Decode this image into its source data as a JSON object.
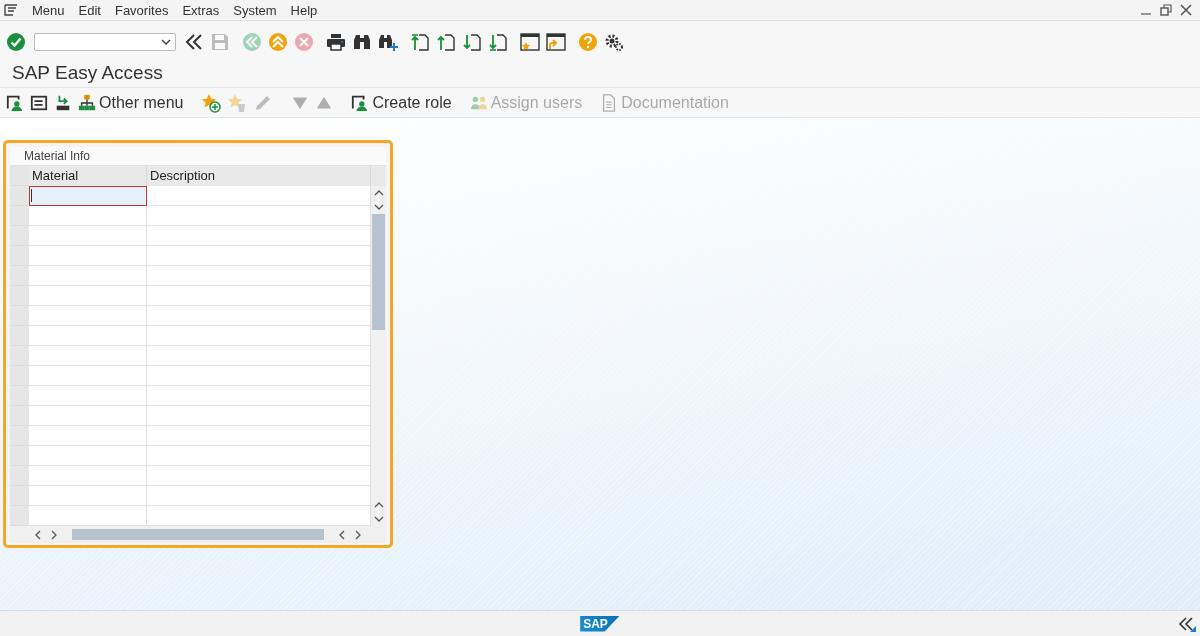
{
  "menu_bar": {
    "items": [
      "Menu",
      "Edit",
      "Favorites",
      "Extras",
      "System",
      "Help"
    ]
  },
  "toolbar": {
    "buttons": [
      {
        "kind": "enter",
        "disabled": false
      },
      {
        "kind": "command-field",
        "disabled": false
      },
      {
        "kind": "collapse",
        "disabled": false
      },
      {
        "kind": "save",
        "disabled": true
      },
      {
        "kind": "back",
        "disabled": true
      },
      {
        "kind": "exit",
        "disabled": false
      },
      {
        "kind": "cancel",
        "disabled": true
      },
      {
        "kind": "print",
        "disabled": false
      },
      {
        "kind": "find",
        "disabled": false
      },
      {
        "kind": "find-next",
        "disabled": false
      },
      {
        "kind": "first-page",
        "disabled": false
      },
      {
        "kind": "prev-page",
        "disabled": false
      },
      {
        "kind": "next-page",
        "disabled": false
      },
      {
        "kind": "last-page",
        "disabled": false
      },
      {
        "kind": "new-session",
        "disabled": false
      },
      {
        "kind": "shortcut",
        "disabled": false
      },
      {
        "kind": "help",
        "disabled": false
      },
      {
        "kind": "settings",
        "disabled": false
      }
    ]
  },
  "title": "SAP Easy Access",
  "app_toolbar": {
    "buttons": [
      {
        "kind": "user-menu",
        "disabled": false
      },
      {
        "kind": "sap-menu",
        "disabled": false
      },
      {
        "kind": "transfer",
        "disabled": false
      },
      {
        "kind": "hierarchy",
        "label": "Other menu",
        "disabled": false
      },
      {
        "kind": "add-favorite",
        "disabled": false
      },
      {
        "kind": "delete-favorite",
        "disabled": true
      },
      {
        "kind": "edit",
        "disabled": true
      },
      {
        "kind": "move-down",
        "disabled": true
      },
      {
        "kind": "move-up",
        "disabled": true
      },
      {
        "kind": "user-menu",
        "label": "Create role",
        "disabled": false
      },
      {
        "kind": "users",
        "label": "Assign users",
        "disabled": true
      },
      {
        "kind": "document",
        "label": "Documentation",
        "disabled": true
      }
    ]
  },
  "panel": {
    "title": "Material Info",
    "table": {
      "columns": [
        "Material",
        "Description"
      ],
      "rows": [
        {
          "focused": true
        },
        {
          "focused": false
        },
        {
          "focused": false
        },
        {
          "focused": false
        },
        {
          "focused": false
        },
        {
          "focused": false
        },
        {
          "focused": false
        },
        {
          "focused": false
        },
        {
          "focused": false
        },
        {
          "focused": false
        },
        {
          "focused": false
        },
        {
          "focused": false
        },
        {
          "focused": false
        },
        {
          "focused": false
        },
        {
          "focused": false
        },
        {
          "focused": false
        },
        {
          "focused": false
        }
      ]
    }
  },
  "status_bar": {
    "logo": "SAP"
  }
}
